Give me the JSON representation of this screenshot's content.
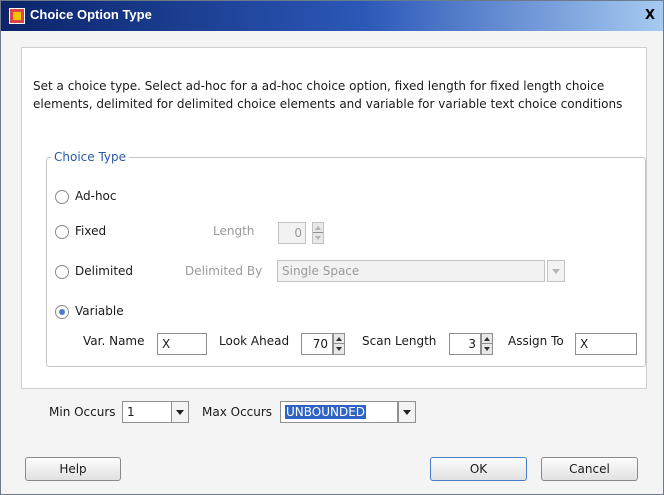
{
  "window": {
    "title": "Choice Option Type",
    "close_label": "X"
  },
  "description": "Set a choice type. Select ad-hoc for a ad-hoc choice option, fixed length for fixed length choice elements, delimited for delimited choice elements and variable for variable text choice conditions",
  "choice_type": {
    "legend": "Choice Type",
    "options": [
      {
        "label": "Ad-hoc",
        "checked": false
      },
      {
        "label": "Fixed",
        "checked": false
      },
      {
        "label": "Delimited",
        "checked": false
      },
      {
        "label": "Variable",
        "checked": true
      }
    ],
    "fixed": {
      "length_label": "Length",
      "length_value": "0"
    },
    "delimited": {
      "by_label": "Delimited By",
      "by_value": "Single Space"
    },
    "variable": {
      "var_name_label": "Var. Name",
      "var_name_value": "X",
      "look_ahead_label": "Look Ahead",
      "look_ahead_value": "70",
      "scan_length_label": "Scan Length",
      "scan_length_value": "3",
      "assign_to_label": "Assign To",
      "assign_to_value": "X"
    }
  },
  "occurs": {
    "min_label": "Min Occurs",
    "min_value": "1",
    "max_label": "Max Occurs",
    "max_value": "UNBOUNDED"
  },
  "buttons": {
    "help": "Help",
    "ok": "OK",
    "cancel": "Cancel"
  }
}
